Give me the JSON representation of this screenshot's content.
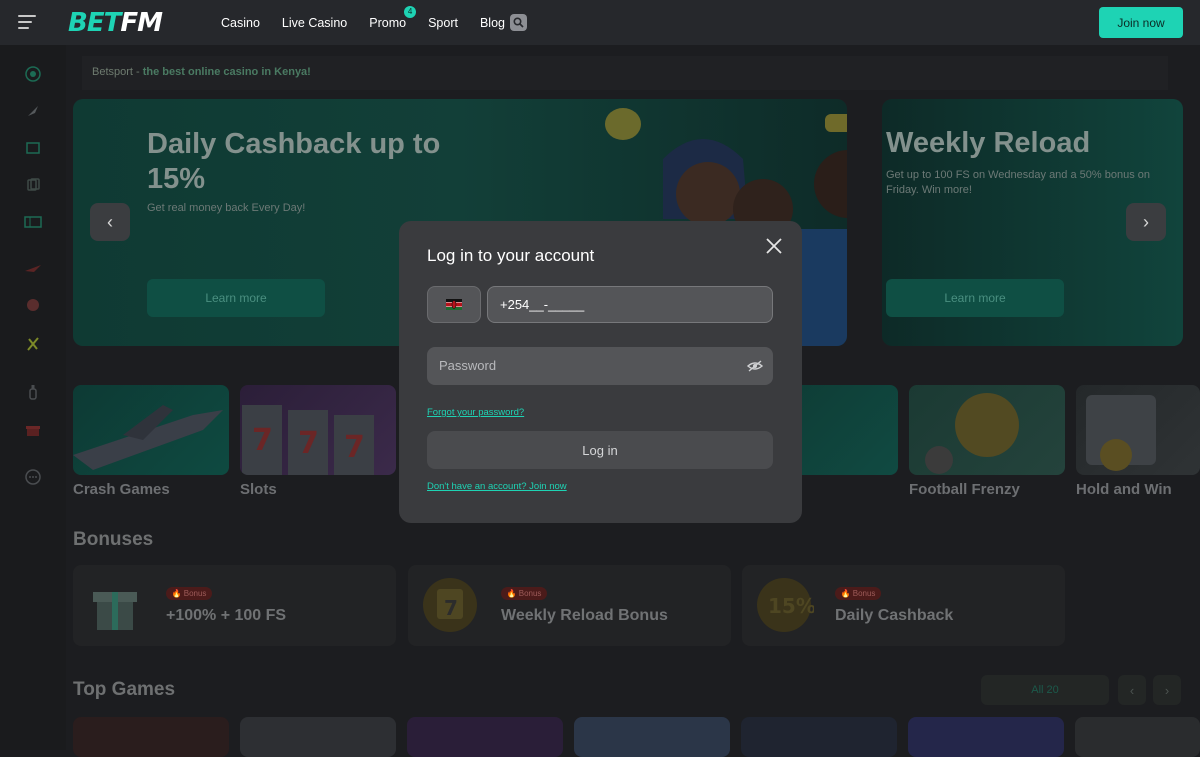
{
  "header": {
    "logo_part1": "BET",
    "logo_part2": "FM",
    "nav": [
      "Casino",
      "Live Casino",
      "Promo",
      "Sport",
      "Blog"
    ],
    "promo_badge": "4",
    "join_label": "Join now"
  },
  "breadcrumb": {
    "prefix": "Betsport - ",
    "text": "the best online casino in Kenya!"
  },
  "banners": [
    {
      "title": "Daily Cashback up to 15%",
      "subtitle": "Get real money back Every Day!",
      "button": "Learn more"
    },
    {
      "title": "Weekly Reload",
      "subtitle": "Get up to 100 FS on Wednesday and a 50% bonus on Friday. Win more!",
      "button": "Learn more"
    }
  ],
  "categories": [
    "Crash Games",
    "Slots",
    "Football Frenzy",
    "Hold and Win"
  ],
  "bonuses": {
    "heading": "Bonuses",
    "tag": "Bonus",
    "items": [
      "+100% + 100 FS",
      "Weekly Reload Bonus",
      "Daily Cashback"
    ]
  },
  "top_games": {
    "heading": "Top Games",
    "all_label": "All 20"
  },
  "modal": {
    "title": "Log in to your account",
    "phone_value": "+254__-_____",
    "password_placeholder": "Password",
    "forgot": "Forgot your password?",
    "login_label": "Log in",
    "signup": "Don't have an account? Join now"
  },
  "colors": {
    "accent": "#1ed3b4",
    "topbar": "#26282c",
    "modal_bg": "#3a3b3e",
    "input_bg": "#545558"
  }
}
